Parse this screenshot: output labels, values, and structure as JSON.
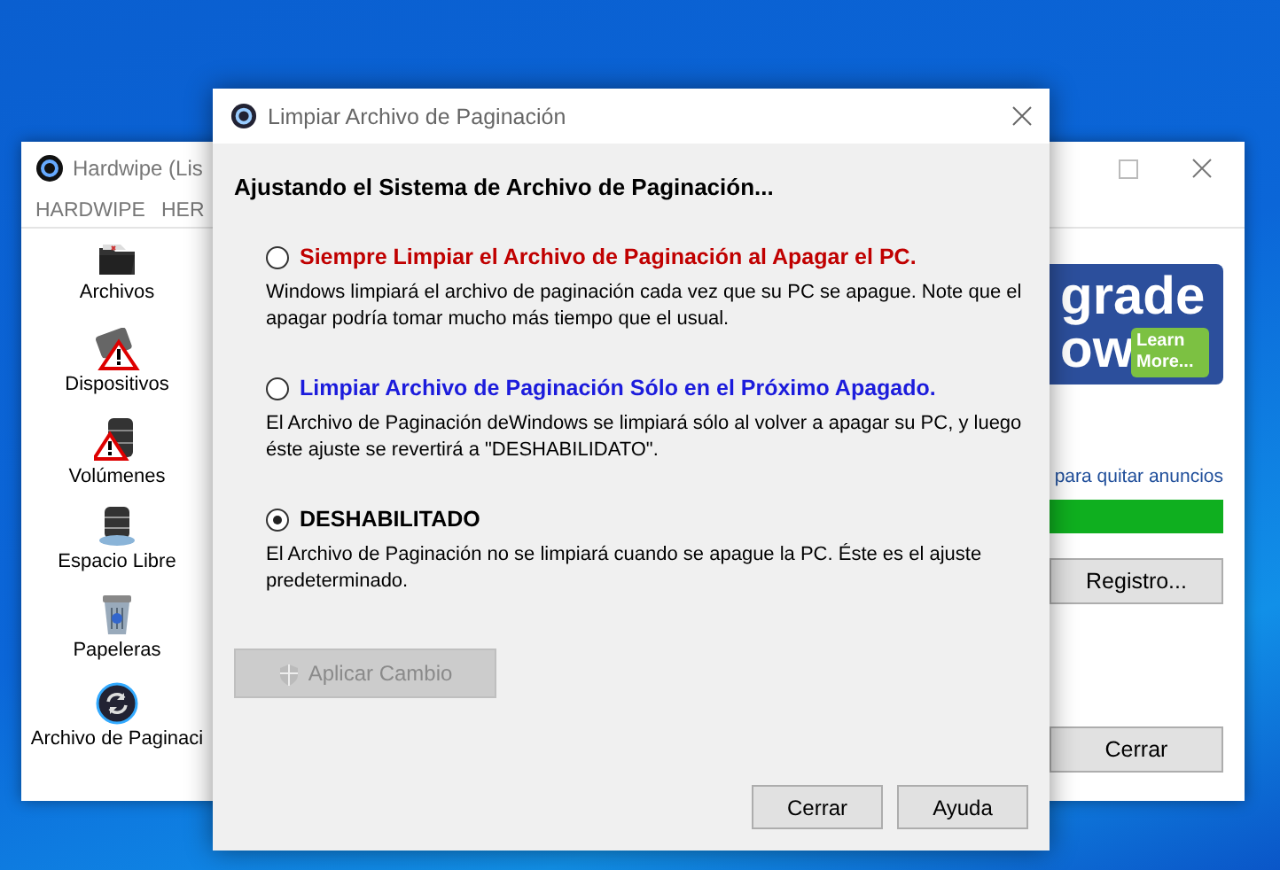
{
  "back_window": {
    "title": "Hardwipe (Lis",
    "menu": [
      "HARDWIPE",
      "HER"
    ],
    "sidebar": [
      {
        "label": "Archivos"
      },
      {
        "label": "Dispositivos"
      },
      {
        "label": "Volúmenes"
      },
      {
        "label": "Espacio Libre"
      },
      {
        "label": "Papeleras"
      },
      {
        "label": "Archivo de Paginaci"
      }
    ],
    "banner": {
      "line_1": "grade",
      "line_2": "ow",
      "button": "Learn More..."
    },
    "link": "para quitar anuncios",
    "progress": {
      "level": 1
    },
    "buttons": [
      "Registro...",
      "Cerrar"
    ]
  },
  "dialog": {
    "title": "Limpiar Archivo de Paginación",
    "heading": "Ajustando el Sistema de Archivo de Paginación...",
    "options": [
      {
        "label": "Siempre Limpiar el Archivo de Paginación al Apagar el PC.",
        "color": "#c00000",
        "selected": false,
        "description": "Windows limpiará el archivo de paginación cada vez que su PC se apague.  Note que el apagar podría tomar mucho más tiempo que el usual."
      },
      {
        "label": "Limpiar Archivo de Paginación Sólo en el Próximo Apagado.",
        "color": "#1c1cdc",
        "selected": false,
        "description": "El Archivo de Paginación deWindows se limpiará sólo al volver a apagar su PC, y luego éste ajuste se revertirá a \"DESHABILIDATO\"."
      },
      {
        "label": "DESHABILITADO",
        "color": "#000000",
        "selected": true,
        "description": "El Archivo de Paginación no se limpiará cuando se apague la PC.  Éste es el ajuste predeterminado."
      }
    ],
    "apply_button": {
      "label": "Aplicar Cambio",
      "disabled": true
    },
    "buttons": [
      "Cerrar",
      "Ayuda"
    ]
  }
}
